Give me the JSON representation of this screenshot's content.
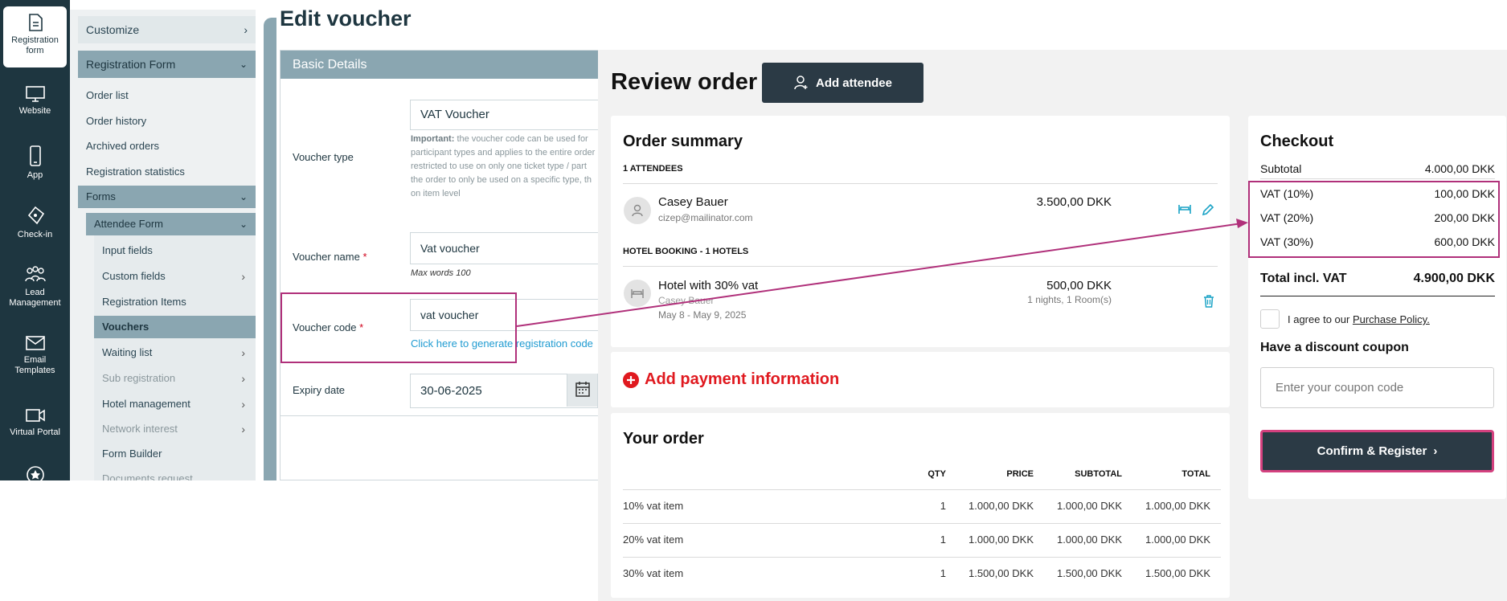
{
  "rail": {
    "items": [
      {
        "label": "Registration form",
        "icon": "document-icon"
      },
      {
        "label": "Website",
        "icon": "monitor-icon"
      },
      {
        "label": "App",
        "icon": "phone-icon"
      },
      {
        "label": "Check-in",
        "icon": "ticket-icon"
      },
      {
        "label": "Lead Management",
        "icon": "people-icon"
      },
      {
        "label": "Email Templates",
        "icon": "mail-icon"
      },
      {
        "label": "Virtual Portal",
        "icon": "video-icon"
      }
    ]
  },
  "nav": {
    "customize": "Customize",
    "registration_form": "Registration Form",
    "items": [
      "Order list",
      "Order history",
      "Archived orders",
      "Registration statistics"
    ],
    "forms": "Forms",
    "attendee_form": "Attendee Form",
    "sub_items": {
      "input_fields": "Input fields",
      "custom_fields": "Custom fields",
      "registration_items": "Registration Items",
      "vouchers": "Vouchers",
      "waiting_list": "Waiting list",
      "sub_registration": "Sub registration",
      "hotel_management": "Hotel management",
      "network_interest": "Network interest",
      "form_builder": "Form Builder",
      "documents_request": "Documents request"
    }
  },
  "edit": {
    "title": "Edit voucher",
    "section": "Basic Details",
    "voucher_type_label": "Voucher type",
    "voucher_type_value": "VAT Voucher",
    "note_bold": "Important:",
    "note_text": " the voucher code can be used for participant types and applies to the entire order restricted to use on only one ticket type / part the order to only be used on a specific type, th on item level",
    "voucher_name_label": "Voucher name",
    "required_mark": "*",
    "voucher_name_value": "Vat voucher",
    "voucher_name_hint": "Max words 100",
    "voucher_code_label": "Voucher code",
    "voucher_code_value": "vat voucher",
    "generate_link": "Click here to generate registration code",
    "expiry_label": "Expiry date",
    "expiry_value": "30-06-2025"
  },
  "review": {
    "title": "Review order",
    "add_attendee": "Add attendee",
    "summary_title": "Order summary",
    "attendees_caption": "1 ATTENDEES",
    "attendee_name": "Casey Bauer",
    "attendee_email": "cizep@mailinator.com",
    "attendee_price": "3.500,00 DKK",
    "hotel_caption": "HOTEL BOOKING - 1 HOTELS",
    "hotel_name": "Hotel with 30% vat",
    "hotel_guest": "Casey Bauer",
    "hotel_dates": "May 8 - May 9, 2025",
    "hotel_price": "500,00 DKK",
    "hotel_nights": "1 nights, 1 Room(s)",
    "add_payment": "Add payment information",
    "your_order_title": "Your order",
    "order_headers": [
      "QTY",
      "PRICE",
      "SUBTOTAL",
      "TOTAL"
    ],
    "order_rows": [
      {
        "item": "10% vat item",
        "qty": "1",
        "price": "1.000,00 DKK",
        "subtotal": "1.000,00 DKK",
        "total": "1.000,00 DKK"
      },
      {
        "item": "20% vat item",
        "qty": "1",
        "price": "1.000,00 DKK",
        "subtotal": "1.000,00 DKK",
        "total": "1.000,00 DKK"
      },
      {
        "item": "30% vat item",
        "qty": "1",
        "price": "1.500,00 DKK",
        "subtotal": "1.500,00 DKK",
        "total": "1.500,00 DKK"
      }
    ]
  },
  "checkout": {
    "title": "Checkout",
    "subtotal_label": "Subtotal",
    "subtotal_value": "4.000,00 DKK",
    "vat_rows": [
      {
        "label": "VAT (10%)",
        "value": "100,00 DKK"
      },
      {
        "label": "VAT (20%)",
        "value": "200,00 DKK"
      },
      {
        "label": "VAT (30%)",
        "value": "600,00 DKK"
      }
    ],
    "total_label": "Total incl. VAT",
    "total_value": "4.900,00 DKK",
    "agree_text": "I agree to our ",
    "agree_link": "Purchase Policy.",
    "coupon_title": "Have a discount coupon",
    "coupon_placeholder": "Enter your coupon code",
    "confirm_label": "Confirm & Register"
  },
  "colors": {
    "rail": "#1e3640",
    "nav_active": "#8aa6b1",
    "highlight": "#b0307a",
    "payment_red": "#e0191f",
    "button_dark": "#2b3a45"
  }
}
